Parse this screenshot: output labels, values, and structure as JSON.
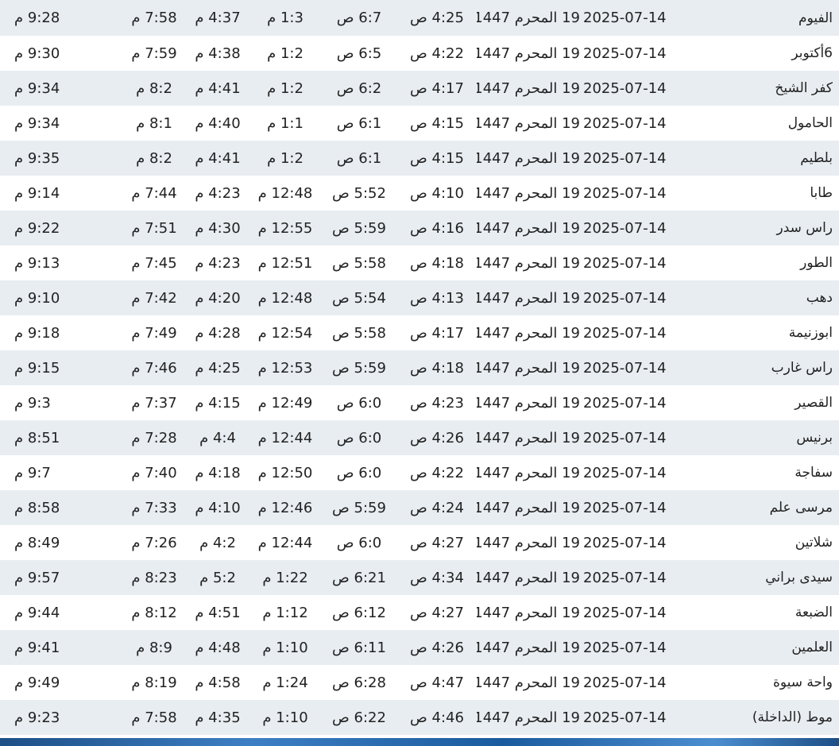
{
  "table": {
    "rows": [
      {
        "city": "الفيوم",
        "gdate": "2025-07-14",
        "hdate": "19 المحرم 1447",
        "fajr": "4:25 ص",
        "sunrise": "6:7 ص",
        "dhuhr": "1:3 م",
        "asr": "4:37 م",
        "maghrib": "7:58 م",
        "isha": "9:28 م"
      },
      {
        "city": "6أكتوبر",
        "gdate": "2025-07-14",
        "hdate": "19 المحرم 1447",
        "fajr": "4:22 ص",
        "sunrise": "6:5 ص",
        "dhuhr": "1:2 م",
        "asr": "4:38 م",
        "maghrib": "7:59 م",
        "isha": "9:30 م"
      },
      {
        "city": "كفر الشيخ",
        "gdate": "2025-07-14",
        "hdate": "19 المحرم 1447",
        "fajr": "4:17 ص",
        "sunrise": "6:2 ص",
        "dhuhr": "1:2 م",
        "asr": "4:41 م",
        "maghrib": "8:2 م",
        "isha": "9:34 م"
      },
      {
        "city": "الحامول",
        "gdate": "2025-07-14",
        "hdate": "19 المحرم 1447",
        "fajr": "4:15 ص",
        "sunrise": "6:1 ص",
        "dhuhr": "1:1 م",
        "asr": "4:40 م",
        "maghrib": "8:1 م",
        "isha": "9:34 م"
      },
      {
        "city": "بلطيم",
        "gdate": "2025-07-14",
        "hdate": "19 المحرم 1447",
        "fajr": "4:15 ص",
        "sunrise": "6:1 ص",
        "dhuhr": "1:2 م",
        "asr": "4:41 م",
        "maghrib": "8:2 م",
        "isha": "9:35 م"
      },
      {
        "city": "طابا",
        "gdate": "2025-07-14",
        "hdate": "19 المحرم 1447",
        "fajr": "4:10 ص",
        "sunrise": "5:52 ص",
        "dhuhr": "12:48 م",
        "asr": "4:23 م",
        "maghrib": "7:44 م",
        "isha": "9:14 م"
      },
      {
        "city": "راس سدر",
        "gdate": "2025-07-14",
        "hdate": "19 المحرم 1447",
        "fajr": "4:16 ص",
        "sunrise": "5:59 ص",
        "dhuhr": "12:55 م",
        "asr": "4:30 م",
        "maghrib": "7:51 م",
        "isha": "9:22 م"
      },
      {
        "city": "الطور",
        "gdate": "2025-07-14",
        "hdate": "19 المحرم 1447",
        "fajr": "4:18 ص",
        "sunrise": "5:58 ص",
        "dhuhr": "12:51 م",
        "asr": "4:23 م",
        "maghrib": "7:45 م",
        "isha": "9:13 م"
      },
      {
        "city": "دهب",
        "gdate": "2025-07-14",
        "hdate": "19 المحرم 1447",
        "fajr": "4:13 ص",
        "sunrise": "5:54 ص",
        "dhuhr": "12:48 م",
        "asr": "4:20 م",
        "maghrib": "7:42 م",
        "isha": "9:10 م"
      },
      {
        "city": "ابوزنيمة",
        "gdate": "2025-07-14",
        "hdate": "19 المحرم 1447",
        "fajr": "4:17 ص",
        "sunrise": "5:58 ص",
        "dhuhr": "12:54 م",
        "asr": "4:28 م",
        "maghrib": "7:49 م",
        "isha": "9:18 م"
      },
      {
        "city": "راس غارب",
        "gdate": "2025-07-14",
        "hdate": "19 المحرم 1447",
        "fajr": "4:18 ص",
        "sunrise": "5:59 ص",
        "dhuhr": "12:53 م",
        "asr": "4:25 م",
        "maghrib": "7:46 م",
        "isha": "9:15 م"
      },
      {
        "city": "القصير",
        "gdate": "2025-07-14",
        "hdate": "19 المحرم 1447",
        "fajr": "4:23 ص",
        "sunrise": "6:0 ص",
        "dhuhr": "12:49 م",
        "asr": "4:15 م",
        "maghrib": "7:37 م",
        "isha": "9:3 م"
      },
      {
        "city": "برنيس",
        "gdate": "2025-07-14",
        "hdate": "19 المحرم 1447",
        "fajr": "4:26 ص",
        "sunrise": "6:0 ص",
        "dhuhr": "12:44 م",
        "asr": "4:4 م",
        "maghrib": "7:28 م",
        "isha": "8:51 م"
      },
      {
        "city": "سفاجة",
        "gdate": "2025-07-14",
        "hdate": "19 المحرم 1447",
        "fajr": "4:22 ص",
        "sunrise": "6:0 ص",
        "dhuhr": "12:50 م",
        "asr": "4:18 م",
        "maghrib": "7:40 م",
        "isha": "9:7 م"
      },
      {
        "city": "مرسى علم",
        "gdate": "2025-07-14",
        "hdate": "19 المحرم 1447",
        "fajr": "4:24 ص",
        "sunrise": "5:59 ص",
        "dhuhr": "12:46 م",
        "asr": "4:10 م",
        "maghrib": "7:33 م",
        "isha": "8:58 م"
      },
      {
        "city": "شلاتين",
        "gdate": "2025-07-14",
        "hdate": "19 المحرم 1447",
        "fajr": "4:27 ص",
        "sunrise": "6:0 ص",
        "dhuhr": "12:44 م",
        "asr": "4:2 م",
        "maghrib": "7:26 م",
        "isha": "8:49 م"
      },
      {
        "city": "سيدى براني",
        "gdate": "2025-07-14",
        "hdate": "19 المحرم 1447",
        "fajr": "4:34 ص",
        "sunrise": "6:21 ص",
        "dhuhr": "1:22 م",
        "asr": "5:2 م",
        "maghrib": "8:23 م",
        "isha": "9:57 م"
      },
      {
        "city": "الضبعة",
        "gdate": "2025-07-14",
        "hdate": "19 المحرم 1447",
        "fajr": "4:27 ص",
        "sunrise": "6:12 ص",
        "dhuhr": "1:12 م",
        "asr": "4:51 م",
        "maghrib": "8:12 م",
        "isha": "9:44 م"
      },
      {
        "city": "العلمين",
        "gdate": "2025-07-14",
        "hdate": "19 المحرم 1447",
        "fajr": "4:26 ص",
        "sunrise": "6:11 ص",
        "dhuhr": "1:10 م",
        "asr": "4:48 م",
        "maghrib": "8:9 م",
        "isha": "9:41 م"
      },
      {
        "city": "واحة سيوة",
        "gdate": "2025-07-14",
        "hdate": "19 المحرم 1447",
        "fajr": "4:47 ص",
        "sunrise": "6:28 ص",
        "dhuhr": "1:24 م",
        "asr": "4:58 م",
        "maghrib": "8:19 م",
        "isha": "9:49 م"
      },
      {
        "city": "موط (الداخلة)",
        "gdate": "2025-07-14",
        "hdate": "19 المحرم 1447",
        "fajr": "4:46 ص",
        "sunrise": "6:22 ص",
        "dhuhr": "1:10 م",
        "asr": "4:35 م",
        "maghrib": "7:58 م",
        "isha": "9:23 م"
      }
    ]
  },
  "colors": {
    "row_odd": "#e8edf1",
    "row_even": "#ffffff",
    "text": "#222222",
    "bottom_bar": "#1d4f86"
  }
}
